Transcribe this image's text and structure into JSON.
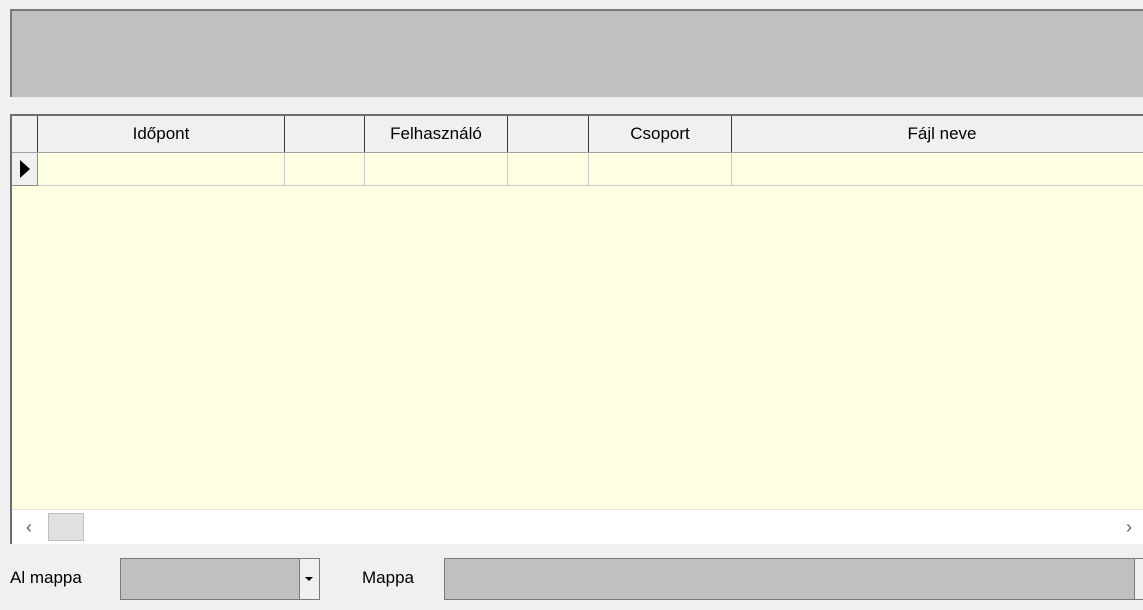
{
  "grid": {
    "columns": [
      "Időpont",
      "",
      "Felhasználó",
      "",
      "Csoport",
      "Fájl neve"
    ],
    "rows": [
      [
        "",
        "",
        "",
        "",
        "",
        ""
      ]
    ]
  },
  "form": {
    "al_mappa_label": "Al mappa",
    "al_mappa_value": "",
    "mappa_label": "Mappa",
    "mappa_value": ""
  },
  "icons": {
    "row_indicator": "row-pointer-icon",
    "scroll_left": "chevron-left-icon",
    "scroll_right": "chevron-right-icon",
    "combo_dropdown": "chevron-down-icon"
  },
  "colors": {
    "grid_background": "#ffffe1",
    "panel_gray": "#c0c0c0",
    "window_background": "#f0f0f0"
  }
}
